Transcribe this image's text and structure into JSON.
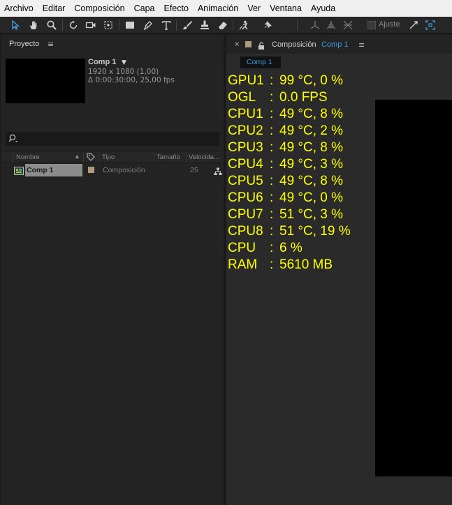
{
  "menu": [
    "Archivo",
    "Editar",
    "Composición",
    "Capa",
    "Efecto",
    "Animación",
    "Ver",
    "Ventana",
    "Ayuda"
  ],
  "toolbar": {
    "tools": [
      "selection-tool-icon",
      "hand-tool-icon",
      "zoom-tool-icon",
      "rotate-tool-icon",
      "camera-tool-icon",
      "pan-behind-tool-icon",
      "rectangle-tool-icon",
      "pen-tool-icon",
      "type-tool-icon",
      "brush-tool-icon",
      "clone-stamp-tool-icon",
      "eraser-tool-icon",
      "roto-brush-tool-icon",
      "puppet-pin-tool-icon",
      "local-axis-icon",
      "world-axis-icon",
      "view-axis-icon",
      "snapping-icon",
      "snapping-toggle-icon"
    ],
    "snap_label": "Ajuste"
  },
  "project": {
    "title": "Proyecto",
    "comp_name": "Comp 1",
    "resolution": "1920 x 1080 (1,00)",
    "duration": "Δ 0:00:30:00, 25,00 fps",
    "columns": {
      "name": "Nombre",
      "type": "Tipo",
      "size": "Tamaño",
      "speed": "Velocida..."
    },
    "item": {
      "name": "Comp 1",
      "type": "Composición",
      "speed": "25"
    },
    "accent_swatch": "#b09a7e"
  },
  "composition": {
    "panel_title": "Composición",
    "panel_comp": "Comp 1",
    "tab": "Comp 1",
    "accent": "#3b9ad6"
  },
  "overlay": {
    "color": "#ffff00",
    "lines": [
      {
        "label": "GPU1",
        "value": "99 °C, 0 %"
      },
      {
        "label": "OGL",
        "value": "0.0 FPS"
      },
      {
        "label": "CPU1",
        "value": "49 °C, 8 %"
      },
      {
        "label": "CPU2",
        "value": "49 °C, 2 %"
      },
      {
        "label": "CPU3",
        "value": "49 °C, 8 %"
      },
      {
        "label": "CPU4",
        "value": "49 °C, 3 %"
      },
      {
        "label": "CPU5",
        "value": "49 °C, 8 %"
      },
      {
        "label": "CPU6",
        "value": "49 °C, 0 %"
      },
      {
        "label": "CPU7",
        "value": "51 °C, 3 %"
      },
      {
        "label": "CPU8",
        "value": "51 °C, 19 %"
      },
      {
        "label": "CPU",
        "value": "6 %"
      },
      {
        "label": "RAM",
        "value": "5610 MB"
      }
    ]
  }
}
